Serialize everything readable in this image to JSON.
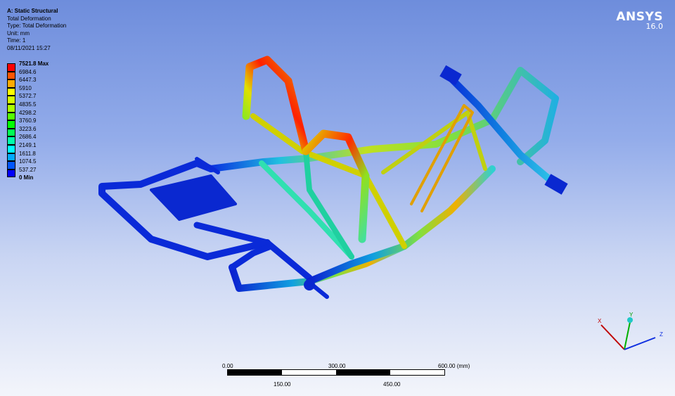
{
  "info": {
    "title": "A: Static Structural",
    "result": "Total Deformation",
    "type": "Type: Total Deformation",
    "unit": "Unit: mm",
    "time": "Time: 1",
    "date": "08/11/2021 15:27"
  },
  "legend": {
    "labels": [
      "7521.8 Max",
      "6984.6",
      "6447.3",
      "5910",
      "5372.7",
      "4835.5",
      "4298.2",
      "3760.9",
      "3223.6",
      "2686.4",
      "2149.1",
      "1611.8",
      "1074.5",
      "537.27",
      "0 Min"
    ],
    "colors": [
      "#ff0000",
      "#ff5500",
      "#ffaa00",
      "#ffff00",
      "#d5ff00",
      "#aaff00",
      "#55ff00",
      "#00ff00",
      "#00ff55",
      "#00ffaa",
      "#00ffff",
      "#00aaff",
      "#0055ff",
      "#0000ff"
    ]
  },
  "logo": {
    "name": "ANSYS",
    "version": "16.0"
  },
  "scale_bar": {
    "top_labels": [
      "0.00",
      "300.00",
      "600.00 (mm)"
    ],
    "bottom_labels": [
      "150.00",
      "450.00"
    ]
  },
  "triad": {
    "x": "X",
    "y": "Y",
    "z": "Z"
  }
}
